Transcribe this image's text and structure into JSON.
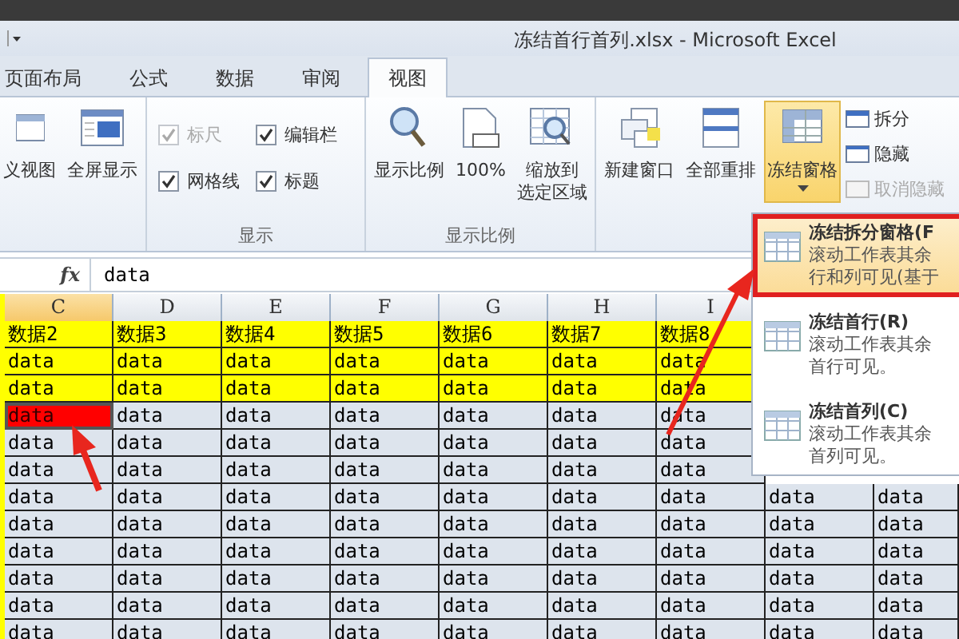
{
  "window": {
    "title": "冻结首行首列.xlsx - Microsoft Excel"
  },
  "tabs": [
    {
      "label": "页面布局",
      "selected": false
    },
    {
      "label": "公式",
      "selected": false
    },
    {
      "label": "数据",
      "selected": false
    },
    {
      "label": "审阅",
      "selected": false
    },
    {
      "label": "视图",
      "selected": true
    }
  ],
  "ribbon": {
    "groups": [
      {
        "items": [
          {
            "kind": "large",
            "label": "义视图"
          },
          {
            "kind": "large",
            "label": "全屏显示"
          }
        ]
      },
      {
        "label": "显示",
        "items": [
          {
            "kind": "check",
            "label": "标尺",
            "checked": true,
            "disabled": true
          },
          {
            "kind": "check",
            "label": "编辑栏",
            "checked": true,
            "disabled": false
          },
          {
            "kind": "check",
            "label": "网格线",
            "checked": true,
            "disabled": false
          },
          {
            "kind": "check",
            "label": "标题",
            "checked": true,
            "disabled": false
          }
        ]
      },
      {
        "label": "显示比例",
        "items": [
          {
            "kind": "large",
            "label": "显示比例"
          },
          {
            "kind": "large",
            "label": "100%"
          },
          {
            "kind": "large",
            "lines": [
              "缩放到",
              "选定区域"
            ]
          }
        ]
      },
      {
        "items": [
          {
            "kind": "large",
            "label": "新建窗口",
            "active": false
          },
          {
            "kind": "large",
            "label": "全部重排",
            "active": false
          },
          {
            "kind": "large",
            "label": "冻结窗格",
            "active": true
          },
          {
            "kind": "small",
            "label": "拆分",
            "disabled": false
          },
          {
            "kind": "small",
            "label": "隐藏",
            "disabled": false
          },
          {
            "kind": "small",
            "label": "取消隐藏",
            "disabled": true
          }
        ]
      }
    ]
  },
  "formula_bar": {
    "fx": "fx",
    "value": "data"
  },
  "sheet": {
    "columns": [
      {
        "label": "C",
        "selected": true
      },
      {
        "label": "D",
        "selected": false
      },
      {
        "label": "E",
        "selected": false
      },
      {
        "label": "F",
        "selected": false
      },
      {
        "label": "G",
        "selected": false
      },
      {
        "label": "H",
        "selected": false
      },
      {
        "label": "I",
        "selected": false
      }
    ],
    "rows": [
      {
        "highlighted": true,
        "cells": [
          {
            "text": "数据2",
            "selected": false
          },
          {
            "text": "数据3",
            "selected": false
          },
          {
            "text": "数据4",
            "selected": false
          },
          {
            "text": "数据5",
            "selected": false
          },
          {
            "text": "数据6",
            "selected": false
          },
          {
            "text": "数据7",
            "selected": false
          },
          {
            "text": "数据8",
            "selected": false
          }
        ]
      },
      {
        "highlighted": true,
        "cells": [
          {
            "text": "data",
            "selected": false
          },
          {
            "text": "data",
            "selected": false
          },
          {
            "text": "data",
            "selected": false
          },
          {
            "text": "data",
            "selected": false
          },
          {
            "text": "data",
            "selected": false
          },
          {
            "text": "data",
            "selected": false
          },
          {
            "text": "data",
            "selected": false
          }
        ]
      },
      {
        "highlighted": true,
        "cells": [
          {
            "text": "data",
            "selected": false
          },
          {
            "text": "data",
            "selected": false
          },
          {
            "text": "data",
            "selected": false
          },
          {
            "text": "data",
            "selected": false
          },
          {
            "text": "data",
            "selected": false
          },
          {
            "text": "data",
            "selected": false
          },
          {
            "text": "data",
            "selected": false
          }
        ]
      },
      {
        "highlighted": false,
        "cells": [
          {
            "text": "data",
            "selected": true
          },
          {
            "text": "data",
            "selected": false
          },
          {
            "text": "data",
            "selected": false
          },
          {
            "text": "data",
            "selected": false
          },
          {
            "text": "data",
            "selected": false
          },
          {
            "text": "data",
            "selected": false
          },
          {
            "text": "data",
            "selected": false
          }
        ]
      },
      {
        "highlighted": false,
        "cells": [
          {
            "text": "data",
            "selected": false
          },
          {
            "text": "data",
            "selected": false
          },
          {
            "text": "data",
            "selected": false
          },
          {
            "text": "data",
            "selected": false
          },
          {
            "text": "data",
            "selected": false
          },
          {
            "text": "data",
            "selected": false
          },
          {
            "text": "data",
            "selected": false
          }
        ]
      },
      {
        "highlighted": false,
        "cells": [
          {
            "text": "data",
            "selected": false
          },
          {
            "text": "data",
            "selected": false
          },
          {
            "text": "data",
            "selected": false
          },
          {
            "text": "data",
            "selected": false
          },
          {
            "text": "data",
            "selected": false
          },
          {
            "text": "data",
            "selected": false
          },
          {
            "text": "data",
            "selected": false
          }
        ]
      },
      {
        "highlighted": false,
        "cells": [
          {
            "text": "data",
            "selected": false
          },
          {
            "text": "data",
            "selected": false
          },
          {
            "text": "data",
            "selected": false
          },
          {
            "text": "data",
            "selected": false
          },
          {
            "text": "data",
            "selected": false
          },
          {
            "text": "data",
            "selected": false
          },
          {
            "text": "data",
            "selected": false
          },
          {
            "text": "data",
            "selected": false
          },
          {
            "text": "data",
            "selected": false
          }
        ]
      },
      {
        "highlighted": false,
        "cells": [
          {
            "text": "data",
            "selected": false
          },
          {
            "text": "data",
            "selected": false
          },
          {
            "text": "data",
            "selected": false
          },
          {
            "text": "data",
            "selected": false
          },
          {
            "text": "data",
            "selected": false
          },
          {
            "text": "data",
            "selected": false
          },
          {
            "text": "data",
            "selected": false
          },
          {
            "text": "data",
            "selected": false
          },
          {
            "text": "data",
            "selected": false
          }
        ]
      },
      {
        "highlighted": false,
        "cells": [
          {
            "text": "data",
            "selected": false
          },
          {
            "text": "data",
            "selected": false
          },
          {
            "text": "data",
            "selected": false
          },
          {
            "text": "data",
            "selected": false
          },
          {
            "text": "data",
            "selected": false
          },
          {
            "text": "data",
            "selected": false
          },
          {
            "text": "data",
            "selected": false
          },
          {
            "text": "data",
            "selected": false
          },
          {
            "text": "data",
            "selected": false
          }
        ]
      },
      {
        "highlighted": false,
        "cells": [
          {
            "text": "data",
            "selected": false
          },
          {
            "text": "data",
            "selected": false
          },
          {
            "text": "data",
            "selected": false
          },
          {
            "text": "data",
            "selected": false
          },
          {
            "text": "data",
            "selected": false
          },
          {
            "text": "data",
            "selected": false
          },
          {
            "text": "data",
            "selected": false
          },
          {
            "text": "data",
            "selected": false
          },
          {
            "text": "data",
            "selected": false
          }
        ]
      },
      {
        "highlighted": false,
        "cells": [
          {
            "text": "data",
            "selected": false
          },
          {
            "text": "data",
            "selected": false
          },
          {
            "text": "data",
            "selected": false
          },
          {
            "text": "data",
            "selected": false
          },
          {
            "text": "data",
            "selected": false
          },
          {
            "text": "data",
            "selected": false
          },
          {
            "text": "data",
            "selected": false
          },
          {
            "text": "data",
            "selected": false
          },
          {
            "text": "data",
            "selected": false
          }
        ]
      },
      {
        "highlighted": false,
        "cells": [
          {
            "text": "data",
            "selected": false
          },
          {
            "text": "data",
            "selected": false
          },
          {
            "text": "data",
            "selected": false
          },
          {
            "text": "data",
            "selected": false
          },
          {
            "text": "data",
            "selected": false
          },
          {
            "text": "data",
            "selected": false
          },
          {
            "text": "data",
            "selected": false
          },
          {
            "text": "data",
            "selected": false
          },
          {
            "text": "data",
            "selected": false
          }
        ]
      }
    ]
  },
  "freeze_menu": {
    "items": [
      {
        "title": "冻结拆分窗格(F",
        "lines": [
          "滚动工作表其余",
          "行和列可见(基于"
        ],
        "selected": true
      },
      {
        "title": "冻结首行(R)",
        "lines": [
          "滚动工作表其余",
          "首行可见。"
        ],
        "selected": false
      },
      {
        "title": "冻结首列(C)",
        "lines": [
          "滚动工作表其余",
          "首列可见。"
        ],
        "selected": false
      }
    ]
  }
}
